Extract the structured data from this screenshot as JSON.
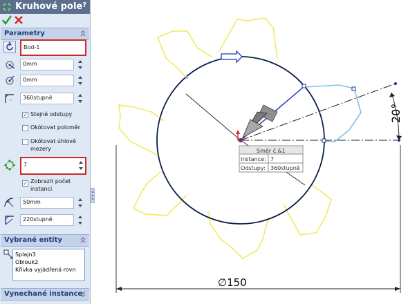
{
  "window": {
    "title": "Kruhové pole",
    "help": "?"
  },
  "sections": {
    "parametry": "Parametry",
    "vybrane_entity": "Vybrané entity",
    "vynechane_instance": "Vynechané instance"
  },
  "params": {
    "center_point": "Bod-1",
    "x_coord": "0mm",
    "y_coord": "0mm",
    "angle_total": "360stupně",
    "equal_spacing_label": "Stejné odstupy",
    "equal_spacing_checked": true,
    "dim_radius_label": "Okótovat poloměr",
    "dim_radius_checked": false,
    "dim_angular_label_1": "Okótovat úhlové",
    "dim_angular_label_2": "mezery",
    "dim_angular_checked": false,
    "instances": "7",
    "show_count_label_1": "Zobrazit počet",
    "show_count_label_2": "instancí",
    "show_count_checked": true,
    "radius": "50mm",
    "arc_angle": "220stupně"
  },
  "selected_entities": [
    "Splajn3",
    "Oblouk2",
    "Křivka vyjádřená rovn"
  ],
  "canvas": {
    "callout_title": "Směr č.&1",
    "callout_rows": [
      {
        "label": "Instance:",
        "value": "7"
      },
      {
        "label": "Odstupy:",
        "value": "360stupně"
      }
    ],
    "angle_dim": "20°",
    "diameter_dim": "∅150"
  },
  "colors": {
    "title_bg": "#5c6f8d",
    "panel_bg": "#dfe8f5",
    "section_bg": "#c4d3ea",
    "highlight_border": "#c82a2a",
    "circle": "#0b1f45",
    "petals": "#f0e84a",
    "selected_petal": "#7ec0e6"
  }
}
